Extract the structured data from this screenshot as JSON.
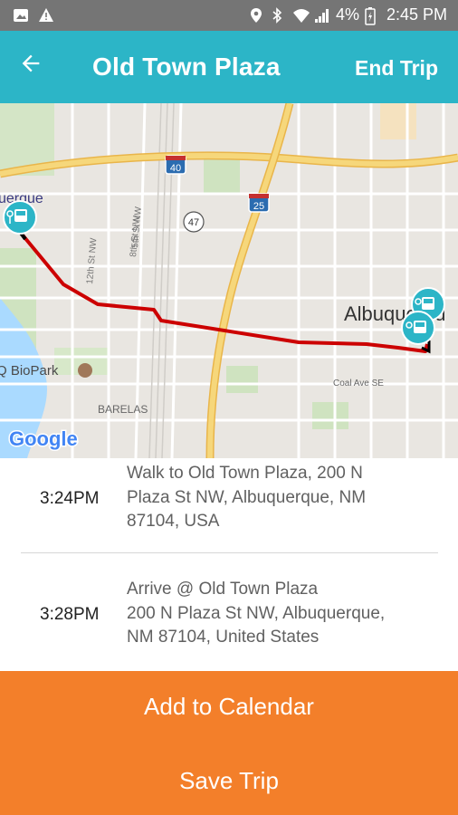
{
  "status_bar": {
    "battery_text": "4%",
    "time": "2:45 PM",
    "icons": [
      "image-icon",
      "warning-icon",
      "location-icon",
      "bluetooth-icon",
      "wifi-icon",
      "signal-icon",
      "battery-icon"
    ]
  },
  "app_bar": {
    "back_icon": "arrow-back-icon",
    "title": "Old Town Plaza",
    "end_trip_label": "End Trip"
  },
  "map": {
    "labels": {
      "albuquerque_left": "uerque",
      "albuquerque_right": "Albuquerqu",
      "biopark": "Q BioPark",
      "barelas": "BARELAS",
      "coal_ave": "Coal Ave SE",
      "street_12th": "12th St NW",
      "street_8th": "8th St NW",
      "street_5th": "5th St NW",
      "hwy_40": "40",
      "hwy_25": "25",
      "hwy_47": "47",
      "google": "Google"
    },
    "colors": {
      "route": "#cc0000",
      "highway": "#f6c55a",
      "marker": "#2cb5c7"
    },
    "markers": [
      "bus-stop-marker-origin",
      "bus-stop-marker-destination"
    ]
  },
  "itinerary": {
    "steps": [
      {
        "time": "3:24PM",
        "description": "Walk to Old Town Plaza, 200 N\nPlaza St NW, Albuquerque, NM\n87104, USA"
      },
      {
        "time": "3:28PM",
        "description": "Arrive @ Old Town Plaza\n200 N Plaza St NW, Albuquerque,\nNM 87104, United States"
      }
    ]
  },
  "actions": {
    "add_to_calendar": "Add to Calendar",
    "save_trip": "Save Trip"
  },
  "colors": {
    "app_bar": "#2cb5c7",
    "action_bar": "#f37f2a",
    "status_bar": "#757575"
  }
}
